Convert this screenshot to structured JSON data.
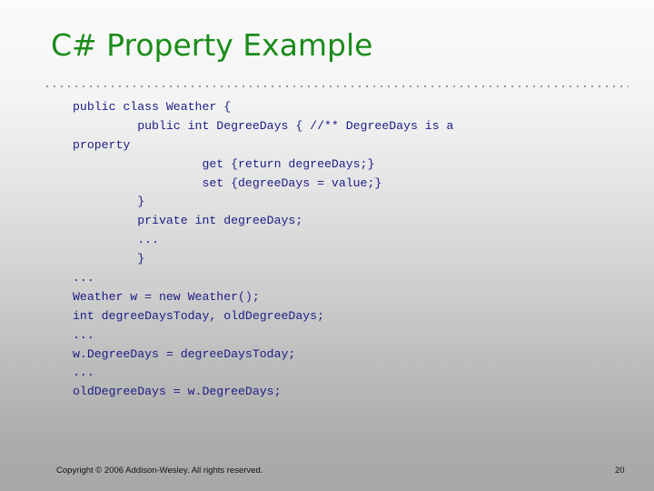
{
  "slide": {
    "title": "C# Property Example",
    "title_color": "#1a8c1a",
    "code_color": "#1c1c86",
    "code_lines": [
      {
        "indent": 0,
        "text": "public class Weather {"
      },
      {
        "indent": 1,
        "text": "public int DegreeDays { //** DegreeDays is a"
      },
      {
        "indent": 0,
        "text": "property"
      },
      {
        "indent": 2,
        "text": "get {return degreeDays;}"
      },
      {
        "indent": 2,
        "text": "set {degreeDays = value;}"
      },
      {
        "indent": 1,
        "text": "}"
      },
      {
        "indent": 1,
        "text": "private int degreeDays;"
      },
      {
        "indent": 1,
        "text": "..."
      },
      {
        "indent": 1,
        "text": "}"
      },
      {
        "indent": 0,
        "text": "..."
      },
      {
        "indent": 0,
        "text": "Weather w = new Weather();"
      },
      {
        "indent": 0,
        "text": "int degreeDaysToday, oldDegreeDays;"
      },
      {
        "indent": 0,
        "text": "..."
      },
      {
        "indent": 0,
        "text": "w.DegreeDays = degreeDaysToday;"
      },
      {
        "indent": 0,
        "text": "..."
      },
      {
        "indent": 0,
        "text": "oldDegreeDays = w.DegreeDays;"
      }
    ]
  },
  "footer": {
    "copyright": "Copyright © 2006 Addison-Wesley. All rights reserved.",
    "page_number": "20"
  }
}
